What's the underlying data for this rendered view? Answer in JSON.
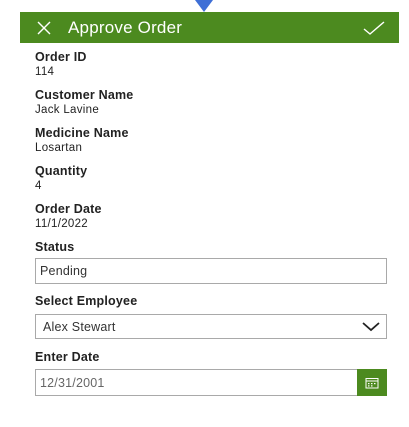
{
  "header": {
    "title": "Approve Order",
    "color": "#4c8a1f"
  },
  "fields": [
    {
      "label": "Order ID",
      "value": "114"
    },
    {
      "label": "Customer Name",
      "value": "Jack Lavine"
    },
    {
      "label": "Medicine Name",
      "value": "Losartan"
    },
    {
      "label": "Quantity",
      "value": "4"
    },
    {
      "label": "Order Date",
      "value": "11/1/2022"
    }
  ],
  "status": {
    "label": "Status",
    "value": "Pending"
  },
  "employee": {
    "label": "Select Employee",
    "selected": "Alex Stewart"
  },
  "enter_date": {
    "label": "Enter Date",
    "value": "12/31/2001"
  },
  "icons": {
    "close": "close-icon",
    "confirm": "checkmark-icon",
    "dropdown": "chevron-down-icon",
    "calendar": "calendar-icon"
  }
}
